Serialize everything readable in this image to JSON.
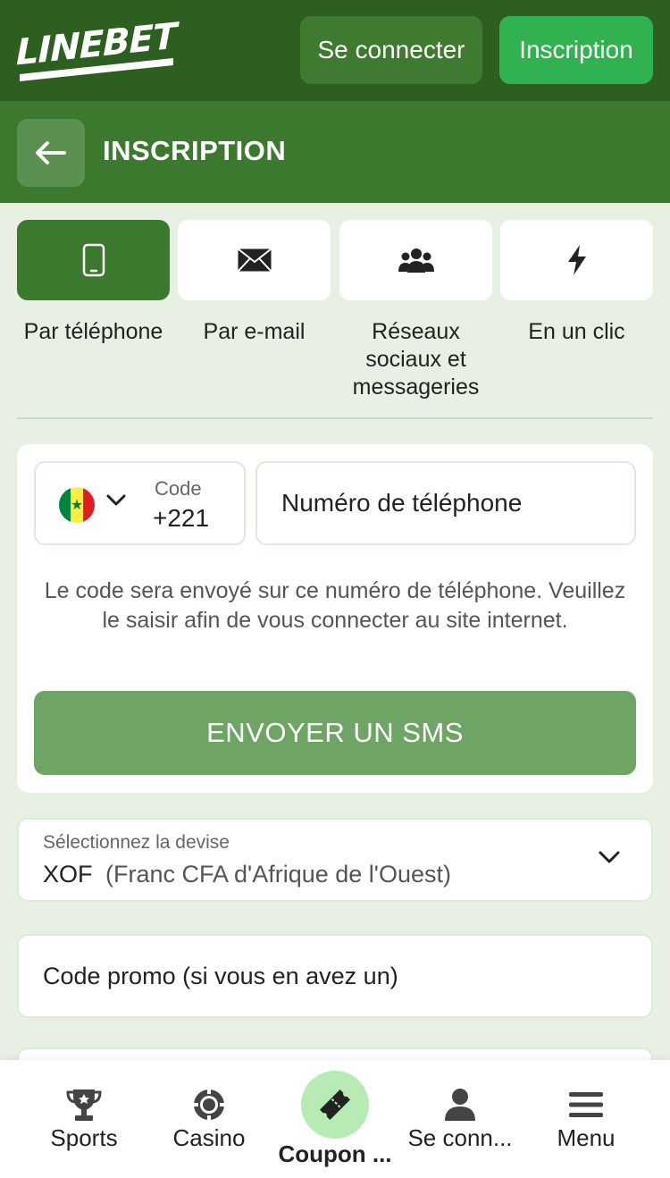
{
  "header": {
    "logo_text": "LINEBET",
    "login_label": "Se connecter",
    "register_label": "Inscription"
  },
  "subheader": {
    "title": "INSCRIPTION"
  },
  "methods": [
    {
      "label": "Par téléphone",
      "icon": "phone-icon",
      "active": true
    },
    {
      "label": "Par e-mail",
      "icon": "envelope-icon",
      "active": false
    },
    {
      "label": "Réseaux sociaux et messageries",
      "icon": "users-icon",
      "active": false
    },
    {
      "label": "En un clic",
      "icon": "lightning-icon",
      "active": false
    }
  ],
  "form": {
    "code_label": "Code",
    "code_value": "+221",
    "phone_placeholder": "Numéro de téléphone",
    "hint": "Le code sera envoyé sur ce numéro de téléphone. Veuillez le saisir afin de vous connecter au site internet.",
    "sms_button": "ENVOYER UN SMS"
  },
  "currency": {
    "label": "Sélectionnez la devise",
    "code": "XOF",
    "name": "(Franc CFA d'Afrique de l'Ouest)"
  },
  "promo": {
    "placeholder": "Code promo (si vous en avez un)"
  },
  "bottom_nav": [
    {
      "label": "Sports",
      "icon": "trophy-icon"
    },
    {
      "label": "Casino",
      "icon": "casino-chip-icon"
    },
    {
      "label": "Coupon ...",
      "icon": "ticket-icon",
      "active": true
    },
    {
      "label": "Se conn...",
      "icon": "user-icon"
    },
    {
      "label": "Menu",
      "icon": "hamburger-icon"
    }
  ],
  "colors": {
    "header_dark": "#2d5f21",
    "header_green": "#3b7a2e",
    "accent_green": "#2fb24f",
    "sms_button": "#6fa564",
    "background": "#e8f0e4"
  }
}
